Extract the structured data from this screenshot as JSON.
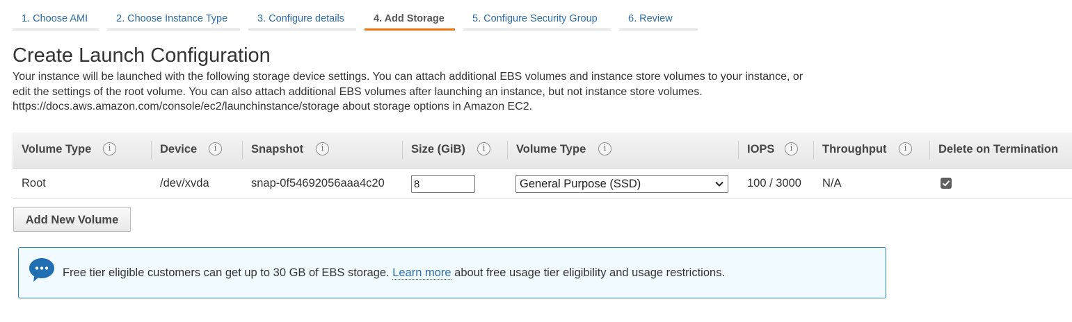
{
  "wizard": {
    "steps": [
      {
        "label": "1. Choose AMI",
        "active": false
      },
      {
        "label": "2. Choose Instance Type",
        "active": false
      },
      {
        "label": "3. Configure details",
        "active": false
      },
      {
        "label": "4. Add Storage",
        "active": true
      },
      {
        "label": "5. Configure Security Group",
        "active": false
      },
      {
        "label": "6. Review",
        "active": false
      }
    ]
  },
  "page": {
    "title": "Create Launch Configuration",
    "description_lines": [
      "Your instance will be launched with the following storage device settings. You can attach additional EBS volumes and instance store volumes to your instance, or",
      "edit the settings of the root volume. You can also attach additional EBS volumes after launching an instance, but not instance store volumes.",
      "https://docs.aws.amazon.com/console/ec2/launchinstance/storage about storage options in Amazon EC2."
    ]
  },
  "table": {
    "columns": [
      {
        "label": "Volume Type",
        "info": "i"
      },
      {
        "label": "Device",
        "info": "i"
      },
      {
        "label": "Snapshot",
        "info": "i"
      },
      {
        "label": "Size (GiB)",
        "info": "i"
      },
      {
        "label": "Volume Type",
        "info": "i"
      },
      {
        "label": "IOPS",
        "info": "i"
      },
      {
        "label": "Throughput",
        "info": "i"
      },
      {
        "label": "Delete on Termination"
      }
    ],
    "rows": [
      {
        "volume_type": "Root",
        "device": "/dev/xvda",
        "snapshot": "snap-0f54692056aaa4c20",
        "size": "8",
        "ebs_volume_type": "General Purpose (SSD)",
        "iops": "100 / 3000",
        "throughput": "N/A",
        "delete_on_termination": true
      }
    ]
  },
  "actions": {
    "add_volume_label": "Add New Volume"
  },
  "alert": {
    "icon": "speech-bubble-icon",
    "text_before": "Free tier eligible customers can get up to 30 GB of EBS storage. ",
    "link_text": "Learn more",
    "text_after": " about free usage tier eligibility and usage restrictions."
  },
  "colors": {
    "link": "#2a6ca8",
    "active_step_underline": "#ec7211",
    "alert_border": "#2a7fb6",
    "alert_background": "#f1faff",
    "alert_icon": "#1f6fb2"
  }
}
